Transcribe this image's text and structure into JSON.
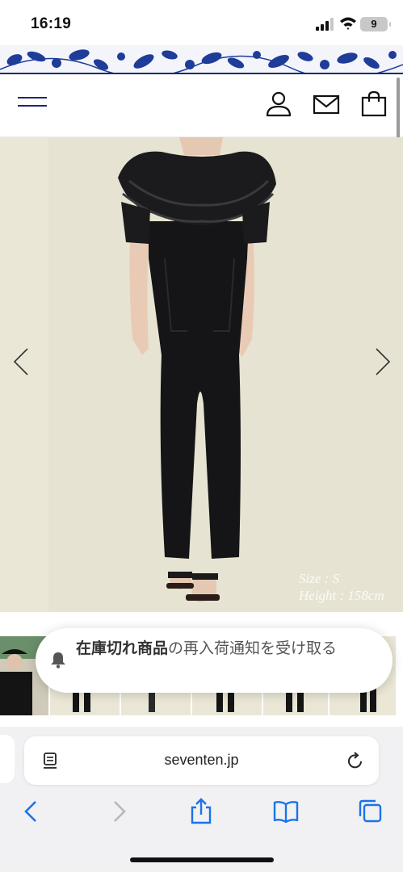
{
  "status_bar": {
    "time": "16:19",
    "battery": "9",
    "icons": [
      "signal-icon",
      "wifi-icon",
      "battery-icon"
    ]
  },
  "header": {
    "icons": [
      "hamburger-menu-icon",
      "account-icon",
      "mail-icon",
      "shopping-bag-icon"
    ],
    "accent_color": "#1a2a6e"
  },
  "product": {
    "size_line": "Size : S",
    "height_line": "Height : 158cm",
    "prev_icon": "chevron-left-icon",
    "next_icon": "chevron-right-icon"
  },
  "notification": {
    "strong_text": "在庫切れ商品",
    "rest_text": "の再入荷通知を受け取る",
    "icon": "bell-icon"
  },
  "browser": {
    "url": "seventen.jp",
    "icons": [
      "reader-icon",
      "reload-icon",
      "back-icon",
      "forward-icon",
      "share-icon",
      "bookmarks-icon",
      "tabs-icon"
    ],
    "tint_color": "#1a73e8"
  }
}
